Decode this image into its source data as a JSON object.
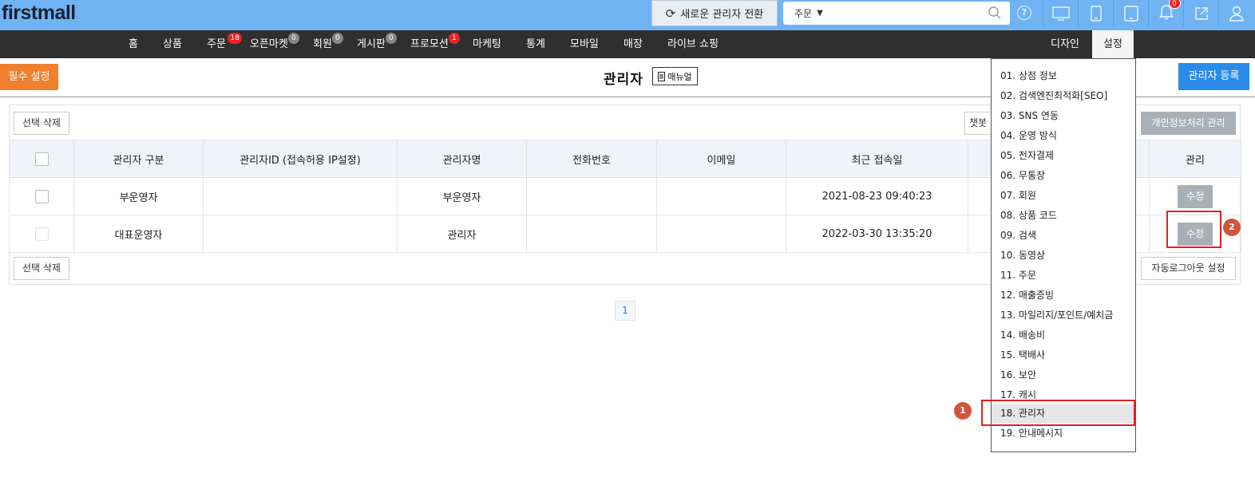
{
  "app": {
    "logo": "firstmall"
  },
  "topbar": {
    "switch_label": "새로운 관리자 전환",
    "search_select": "주문",
    "bell_count": "0",
    "icons": [
      "monitor-icon",
      "mobile-icon",
      "tablet-icon",
      "bell-icon",
      "external-link-icon",
      "user-icon"
    ]
  },
  "nav": {
    "items": [
      {
        "label": "홈"
      },
      {
        "label": "상품"
      },
      {
        "label": "주문",
        "badge": "18"
      },
      {
        "label": "오픈마켓",
        "badge": "0"
      },
      {
        "label": "회원",
        "badge": "0"
      },
      {
        "label": "게시판",
        "badge": "0"
      },
      {
        "label": "프로모션",
        "badge": "1"
      },
      {
        "label": "마케팅"
      },
      {
        "label": "통계"
      },
      {
        "label": "모바일"
      },
      {
        "label": "매장"
      },
      {
        "label": "라이브 쇼핑"
      }
    ],
    "right": [
      {
        "label": "디자인"
      },
      {
        "label": "설정"
      }
    ]
  },
  "header": {
    "required_settings": "필수 설정",
    "title": "관리자",
    "manual": "매뉴얼",
    "register": "관리자 등록"
  },
  "toolbar": {
    "delete_selected": "선택 삭제",
    "chatbot_partial": "챗봇",
    "privacy_manage": "개인정보처리 관리",
    "auto_logout": "자동로그아웃 설정"
  },
  "table": {
    "headers": [
      "",
      "관리자 구분",
      "관리자ID (접속허용 IP설정)",
      "관리자명",
      "전화번호",
      "이메일",
      "최근 접속일",
      "",
      "관리"
    ],
    "rows": [
      {
        "type": "부운영자",
        "id": "",
        "name": "부운영자",
        "phone": "",
        "email": "",
        "last_login": "2021-08-23 09:40:23",
        "action": "수정"
      },
      {
        "type": "대표운영자",
        "id": "",
        "name": "관리자",
        "phone": "",
        "email": "",
        "last_login": "2022-03-30 13:35:20",
        "action": "수정"
      }
    ]
  },
  "pagination": {
    "current": "1"
  },
  "settings_menu": {
    "items": [
      "01. 상점 정보",
      "02. 검색엔진최적화[SEO]",
      "03. SNS 연동",
      "04. 운영 방식",
      "05. 전자결제",
      "06. 무통장",
      "07. 회원",
      "08. 상품 코드",
      "09. 검색",
      "10. 동영상",
      "11. 주문",
      "12. 매출증빙",
      "13. 마일리지/포인트/예치금",
      "14. 배송비",
      "15. 택배사",
      "16. 보안",
      "17. 캐시",
      "18. 관리자",
      "19. 안내메시지"
    ],
    "highlighted_index": 17
  },
  "annotations": {
    "marker1": "1",
    "marker2": "2"
  },
  "colors": {
    "topbar": "#6fb3f5",
    "nav": "#2f2f2f",
    "accent_orange": "#f07f2e",
    "accent_blue": "#2b8bea",
    "highlight_red": "#e21f26"
  }
}
